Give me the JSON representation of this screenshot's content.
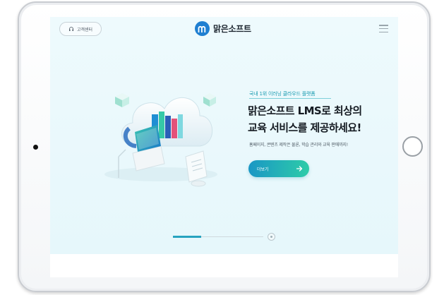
{
  "header": {
    "support_label": "고객센터",
    "logo_text": "맑은소프트"
  },
  "hero": {
    "eyebrow": "국내 1위 이러닝 클라우드 플랫폼",
    "headline_line1": "맑은소프트 LMS로 최상의",
    "headline_line2": "교육 서비스를 제공하세요!",
    "description": "홈페이지, 콘텐츠 제작은 물론, 학습 관리와 교육 판매까지!",
    "more_button_label": "더보기"
  },
  "pagination": {
    "current_slide": 1
  },
  "colors": {
    "brand_blue": "#1f7fd1",
    "accent_teal": "#1a9bb0",
    "button_gradient_start": "#1a97c5",
    "button_gradient_end": "#2dcca8",
    "hero_background": "#eefafd"
  },
  "icons": {
    "support": "headset-icon",
    "logo": "logo-m-icon",
    "menu": "hamburger-menu-icon",
    "more": "arrow-right-icon",
    "pager": "pager-dot-icon"
  }
}
